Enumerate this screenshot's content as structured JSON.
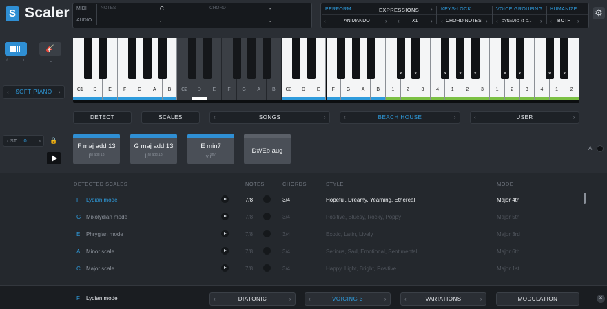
{
  "app": {
    "logo_icon": "S",
    "title": "Scaler"
  },
  "io": {
    "midi_label": "MIDI",
    "audio_label": "AUDIO",
    "notes_label": "NOTES",
    "chord_label": "CHORD",
    "notes_value": "C",
    "chord_value": "-",
    "notes_value2": ".",
    "chord_value2": "."
  },
  "performance": {
    "perform_label": "PERFORM",
    "expressions_label": "EXPRESSIONS",
    "keys_lock_label": "KEYS-LOCK",
    "voice_grouping_label": "VOICE GROUPING",
    "humanize_label": "HUMANIZE",
    "perform_value": "ANIMANDO",
    "speed_value": "X1",
    "keys_lock_value": "CHORD NOTES",
    "voice_grouping_value": "DYNAMIC +1 O...",
    "humanize_value": "BOTH"
  },
  "sound": {
    "preset": "SOFT PIANO"
  },
  "keyboard": {
    "white_labels": [
      "C1",
      "D",
      "E",
      "F",
      "G",
      "A",
      "B",
      "C2",
      "D",
      "E",
      "F",
      "G",
      "A",
      "B",
      "C3",
      "D",
      "E",
      "F",
      "G",
      "A",
      "B",
      "1",
      "2",
      "3",
      "4",
      "1",
      "2",
      "3",
      "1",
      "2",
      "3",
      "4",
      "1",
      "2"
    ],
    "stripe_blue": "#2e9bdc",
    "stripe_green": "#7bc043"
  },
  "modes": {
    "detect": "DETECT",
    "scales": "SCALES",
    "songs": "SONGS",
    "beach_house": "BEACH HOUSE",
    "user": "USER"
  },
  "transpose": {
    "label": "ST:",
    "value": "0"
  },
  "pads": [
    {
      "name": "F maj add 13",
      "roman": "I",
      "quality": "M add 13"
    },
    {
      "name": "G maj add 13",
      "roman": "II",
      "quality": "M add 13"
    },
    {
      "name": "E min7",
      "roman": "vii",
      "quality": "m7"
    },
    {
      "name": "D#/Eb aug",
      "roman": "",
      "quality": ""
    }
  ],
  "a_toggle_label": "A",
  "table": {
    "headers": {
      "detected_scales": "DETECTED SCALES",
      "notes": "NOTES",
      "chords": "CHORDS",
      "style": "STYLE",
      "mode": "MODE"
    },
    "rows": [
      {
        "root": "F",
        "name": "Lydian mode",
        "notes": "7/8",
        "chords": "3/4",
        "style": "Hopeful, Dreamy, Yearning, Ethereal",
        "mode": "Major 4th"
      },
      {
        "root": "G",
        "name": "Mixolydian mode",
        "notes": "7/8",
        "chords": "3/4",
        "style": "Positive, Bluesy, Rocky, Poppy",
        "mode": "Major 5th"
      },
      {
        "root": "E",
        "name": "Phrygian mode",
        "notes": "7/8",
        "chords": "3/4",
        "style": "Exotic, Latin, Lively",
        "mode": "Major 3rd"
      },
      {
        "root": "A",
        "name": "Minor scale",
        "notes": "7/8",
        "chords": "3/4",
        "style": "Serious, Sad, Emotional, Sentimental",
        "mode": "Major 6th"
      },
      {
        "root": "C",
        "name": "Major scale",
        "notes": "7/8",
        "chords": "3/4",
        "style": "Happy, Light, Bright, Positive",
        "mode": "Major 1st"
      }
    ]
  },
  "bottom": {
    "root": "F",
    "scale": "Lydian mode",
    "diatonic": "DIATONIC",
    "voicing": "VOICING 3",
    "variations": "VARIATIONS",
    "modulation": "MODULATION"
  }
}
